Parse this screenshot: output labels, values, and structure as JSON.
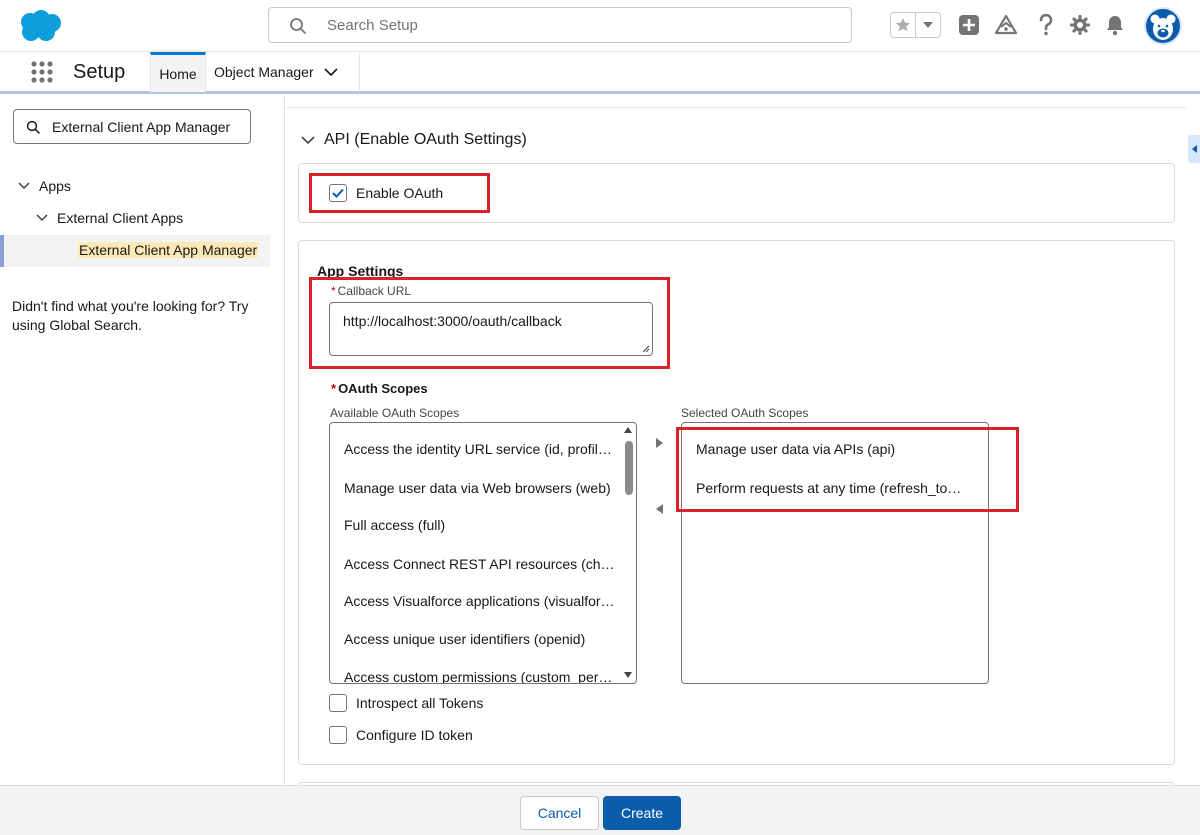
{
  "header": {
    "search_placeholder": "Search Setup",
    "icons": [
      "salesforce-logo",
      "favorites-star-icon",
      "favorites-dropdown-icon",
      "add-icon",
      "trailhead-icon",
      "help-icon",
      "gear-icon",
      "notifications-bell-icon",
      "avatar"
    ]
  },
  "context_bar": {
    "app_name": "Setup",
    "tabs": [
      {
        "label": "Home",
        "active": true
      },
      {
        "label": "Object Manager"
      }
    ]
  },
  "sidebar": {
    "quickfind_value": "External Client App Manager",
    "tree": [
      {
        "label": "Apps"
      },
      {
        "label": "External Client Apps"
      },
      {
        "label": "External Client App Manager",
        "selected": true
      }
    ],
    "no_find_text": "Didn't find what you're looking for? Try using Global Search."
  },
  "main": {
    "section_title": "API (Enable OAuth Settings)",
    "enable_oauth": {
      "label": "Enable OAuth",
      "checked": true
    },
    "app_settings": {
      "title": "App Settings",
      "callback": {
        "label": "Callback URL",
        "value": "http://localhost:3000/oauth/callback"
      },
      "scopes_label": "OAuth Scopes",
      "available_label": "Available OAuth Scopes",
      "selected_label": "Selected OAuth Scopes",
      "available": [
        "Access the identity URL service (id, profile, email, address, phone)",
        "Manage user data via Web browsers (web)",
        "Full access (full)",
        "Access Connect REST API resources (chatter_api)",
        "Access Visualforce applications (visualforce)",
        "Access unique user identifiers (openid)",
        "Access custom permissions (custom_permissions)"
      ],
      "selected": [
        "Manage user data via APIs (api)",
        "Perform requests at any time (refresh_token, offline_access)"
      ],
      "introspect": {
        "label": "Introspect all Tokens",
        "checked": false
      },
      "id_token": {
        "label": "Configure ID token",
        "checked": false
      }
    }
  },
  "footer": {
    "cancel_label": "Cancel",
    "create_label": "Create"
  },
  "colors": {
    "brand_blue": "#0b5cab",
    "highlight_red": "#d8232a",
    "selected_highlight": "#fde9b5"
  }
}
